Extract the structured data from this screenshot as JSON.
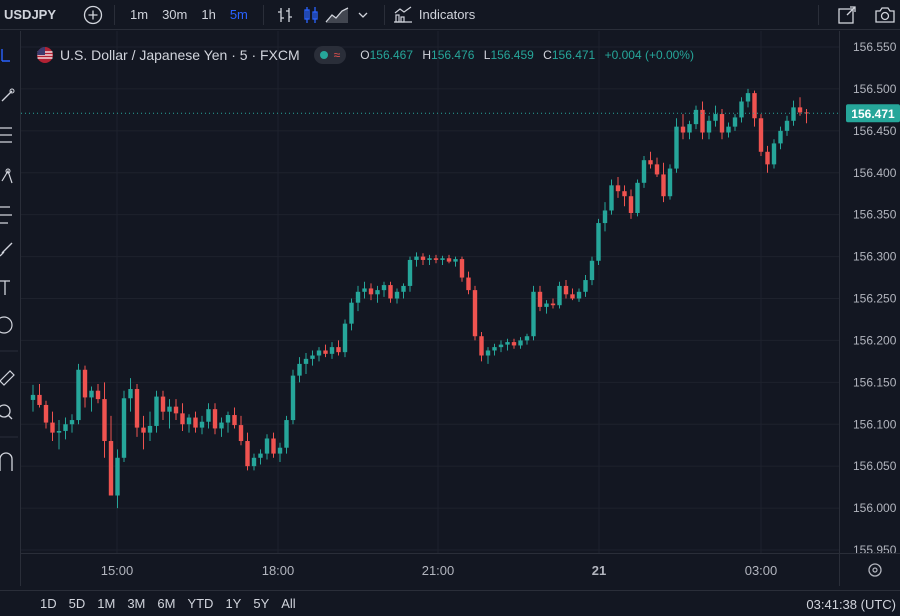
{
  "toolbar": {
    "symbol": "USDJPY",
    "intervals": [
      "1m",
      "30m",
      "1h",
      "5m"
    ],
    "active_interval": "5m",
    "indicators_label": "Indicators",
    "icons": [
      "add-symbol-icon",
      "bar-style-icon",
      "candles-icon",
      "area-chart-icon",
      "chevron-down-icon",
      "indicators-icon",
      "fullscreen-icon",
      "camera-icon"
    ]
  },
  "legend": {
    "title": "U.S. Dollar / Japanese Yen · 5 · FXCM",
    "o_label": "O",
    "o": "156.467",
    "h_label": "H",
    "h": "156.476",
    "l_label": "L",
    "l": "156.459",
    "c_label": "C",
    "c": "156.471",
    "change": "+0.004 (+0.00%)"
  },
  "colors": {
    "background": "#131722",
    "up": "#26a69a",
    "down": "#ef5350",
    "accent": "#2962ff",
    "grid": "#1e222d"
  },
  "price_tag": "156.471",
  "bottom": {
    "ranges": [
      "1D",
      "5D",
      "1M",
      "3M",
      "6M",
      "YTD",
      "1Y",
      "5Y",
      "All"
    ],
    "clock": "03:41:38 (UTC)"
  },
  "chart_data": {
    "type": "candlestick",
    "y_ticks": [
      "156.550",
      "156.500",
      "156.450",
      "156.400",
      "156.350",
      "156.300",
      "156.250",
      "156.200",
      "156.150",
      "156.100",
      "156.050",
      "156.000",
      "155.950"
    ],
    "x_ticks": [
      "15:00",
      "18:00",
      "21:00",
      "21",
      "03:00"
    ],
    "ylim": [
      155.95,
      156.55
    ],
    "last_price": 156.471,
    "grid": true,
    "bar_interval_minutes": 5,
    "first_bar_time": "14:00",
    "candles": [
      [
        156.129,
        156.147,
        156.115,
        156.135
      ],
      [
        156.135,
        156.148,
        156.12,
        156.123
      ],
      [
        156.123,
        156.128,
        156.095,
        156.102
      ],
      [
        156.102,
        156.115,
        156.08,
        156.09
      ],
      [
        156.09,
        156.105,
        156.07,
        156.092
      ],
      [
        156.092,
        156.108,
        156.082,
        156.1
      ],
      [
        156.1,
        156.112,
        156.09,
        156.105
      ],
      [
        156.105,
        156.172,
        156.1,
        156.165
      ],
      [
        156.165,
        156.17,
        156.12,
        156.132
      ],
      [
        156.132,
        156.145,
        156.115,
        156.14
      ],
      [
        156.14,
        156.148,
        156.125,
        156.13
      ],
      [
        156.13,
        156.15,
        156.06,
        156.08
      ],
      [
        156.08,
        156.11,
        156.02,
        156.015
      ],
      [
        156.015,
        156.07,
        156.0,
        156.06
      ],
      [
        156.06,
        156.14,
        156.055,
        156.131
      ],
      [
        156.131,
        156.155,
        156.115,
        156.142
      ],
      [
        156.142,
        156.148,
        156.085,
        156.096
      ],
      [
        156.096,
        156.11,
        156.07,
        156.09
      ],
      [
        156.09,
        156.115,
        156.08,
        156.098
      ],
      [
        156.098,
        156.14,
        156.09,
        156.133
      ],
      [
        156.133,
        156.14,
        156.105,
        156.115
      ],
      [
        156.115,
        156.13,
        156.095,
        156.121
      ],
      [
        156.121,
        156.13,
        156.105,
        156.113
      ],
      [
        156.113,
        156.125,
        156.092,
        156.1
      ],
      [
        156.1,
        156.112,
        156.09,
        156.108
      ],
      [
        156.108,
        156.115,
        156.09,
        156.096
      ],
      [
        156.096,
        156.11,
        156.088,
        156.103
      ],
      [
        156.103,
        156.125,
        156.095,
        156.118
      ],
      [
        156.118,
        156.125,
        156.088,
        156.095
      ],
      [
        156.095,
        156.108,
        156.085,
        156.102
      ],
      [
        156.102,
        156.115,
        156.09,
        156.111
      ],
      [
        156.111,
        156.12,
        156.095,
        156.099
      ],
      [
        156.099,
        156.11,
        156.075,
        156.08
      ],
      [
        156.08,
        156.09,
        156.045,
        156.05
      ],
      [
        156.05,
        156.065,
        156.045,
        156.06
      ],
      [
        156.06,
        156.07,
        156.052,
        156.065
      ],
      [
        156.065,
        156.088,
        156.058,
        156.083
      ],
      [
        156.083,
        156.09,
        156.06,
        156.065
      ],
      [
        156.065,
        156.078,
        156.055,
        156.072
      ],
      [
        156.072,
        156.11,
        156.065,
        156.105
      ],
      [
        156.105,
        156.165,
        156.1,
        156.158
      ],
      [
        156.158,
        156.18,
        156.15,
        156.172
      ],
      [
        156.172,
        156.185,
        156.16,
        156.178
      ],
      [
        156.178,
        156.188,
        156.17,
        156.182
      ],
      [
        156.182,
        156.192,
        156.175,
        156.188
      ],
      [
        156.188,
        156.195,
        156.18,
        156.184
      ],
      [
        156.184,
        156.198,
        156.178,
        156.192
      ],
      [
        156.192,
        156.2,
        156.182,
        156.186
      ],
      [
        156.186,
        156.225,
        156.18,
        156.22
      ],
      [
        156.22,
        156.25,
        156.212,
        156.245
      ],
      [
        156.245,
        156.265,
        156.235,
        156.258
      ],
      [
        156.258,
        156.27,
        156.25,
        156.262
      ],
      [
        156.262,
        156.268,
        156.248,
        156.255
      ],
      [
        156.255,
        156.265,
        156.245,
        156.26
      ],
      [
        156.26,
        156.27,
        156.252,
        156.266
      ],
      [
        156.266,
        156.27,
        156.245,
        156.25
      ],
      [
        156.25,
        156.262,
        156.244,
        156.258
      ],
      [
        156.258,
        156.268,
        156.25,
        156.265
      ],
      [
        156.265,
        156.3,
        156.258,
        156.296
      ],
      [
        156.296,
        156.305,
        156.288,
        156.3
      ],
      [
        156.3,
        156.304,
        156.29,
        156.296
      ],
      [
        156.296,
        156.302,
        156.29,
        156.298
      ],
      [
        156.298,
        156.302,
        156.292,
        156.296
      ],
      [
        156.296,
        156.301,
        156.29,
        156.298
      ],
      [
        156.298,
        156.302,
        156.292,
        156.294
      ],
      [
        156.294,
        156.3,
        156.288,
        156.297
      ],
      [
        156.297,
        156.3,
        156.27,
        156.275
      ],
      [
        156.275,
        156.282,
        156.255,
        156.26
      ],
      [
        156.26,
        156.265,
        156.2,
        156.205
      ],
      [
        156.205,
        156.21,
        156.175,
        156.182
      ],
      [
        156.182,
        156.192,
        156.172,
        156.188
      ],
      [
        156.188,
        156.196,
        156.182,
        156.192
      ],
      [
        156.192,
        156.2,
        156.186,
        156.195
      ],
      [
        156.195,
        156.202,
        156.188,
        156.198
      ],
      [
        156.198,
        156.202,
        156.19,
        156.194
      ],
      [
        156.194,
        156.204,
        156.19,
        156.2
      ],
      [
        156.2,
        156.208,
        156.195,
        156.205
      ],
      [
        156.205,
        156.265,
        156.2,
        156.258
      ],
      [
        156.258,
        156.265,
        156.235,
        156.24
      ],
      [
        156.24,
        156.248,
        156.232,
        156.244
      ],
      [
        156.244,
        156.25,
        156.238,
        156.242
      ],
      [
        156.242,
        156.27,
        156.238,
        156.265
      ],
      [
        156.265,
        156.272,
        156.25,
        156.255
      ],
      [
        156.255,
        156.262,
        156.248,
        156.25
      ],
      [
        156.25,
        156.262,
        156.246,
        156.258
      ],
      [
        156.258,
        156.278,
        156.252,
        156.272
      ],
      [
        156.272,
        156.3,
        156.266,
        156.295
      ],
      [
        156.295,
        156.345,
        156.29,
        156.34
      ],
      [
        156.34,
        156.365,
        156.33,
        156.355
      ],
      [
        156.355,
        156.392,
        156.35,
        156.385
      ],
      [
        156.385,
        156.395,
        156.37,
        156.378
      ],
      [
        156.378,
        156.385,
        156.36,
        156.372
      ],
      [
        156.372,
        156.38,
        156.345,
        156.352
      ],
      [
        156.352,
        156.392,
        156.348,
        156.388
      ],
      [
        156.388,
        156.42,
        156.382,
        156.415
      ],
      [
        156.415,
        156.425,
        156.405,
        156.41
      ],
      [
        156.41,
        156.418,
        156.395,
        156.398
      ],
      [
        156.398,
        156.412,
        156.365,
        156.372
      ],
      [
        156.372,
        156.41,
        156.368,
        156.405
      ],
      [
        156.405,
        156.465,
        156.4,
        156.455
      ],
      [
        156.455,
        156.47,
        156.44,
        156.448
      ],
      [
        156.448,
        156.462,
        156.44,
        156.458
      ],
      [
        156.458,
        156.48,
        156.452,
        156.475
      ],
      [
        156.475,
        156.485,
        156.44,
        156.448
      ],
      [
        156.448,
        156.468,
        156.44,
        156.462
      ],
      [
        156.462,
        156.48,
        156.455,
        156.47
      ],
      [
        156.47,
        156.476,
        156.44,
        156.448
      ],
      [
        156.448,
        156.46,
        156.442,
        156.455
      ],
      [
        156.455,
        156.47,
        156.45,
        156.466
      ],
      [
        156.466,
        156.49,
        156.46,
        156.485
      ],
      [
        156.485,
        156.5,
        156.478,
        156.495
      ],
      [
        156.495,
        156.498,
        156.455,
        156.465
      ],
      [
        156.465,
        156.47,
        156.42,
        156.425
      ],
      [
        156.425,
        156.432,
        156.4,
        156.41
      ],
      [
        156.41,
        156.44,
        156.405,
        156.435
      ],
      [
        156.435,
        156.455,
        156.428,
        156.45
      ],
      [
        156.45,
        156.468,
        156.444,
        156.462
      ],
      [
        156.462,
        156.486,
        156.456,
        156.478
      ],
      [
        156.478,
        156.49,
        156.468,
        156.472
      ],
      [
        156.472,
        156.476,
        156.459,
        156.471
      ]
    ]
  }
}
